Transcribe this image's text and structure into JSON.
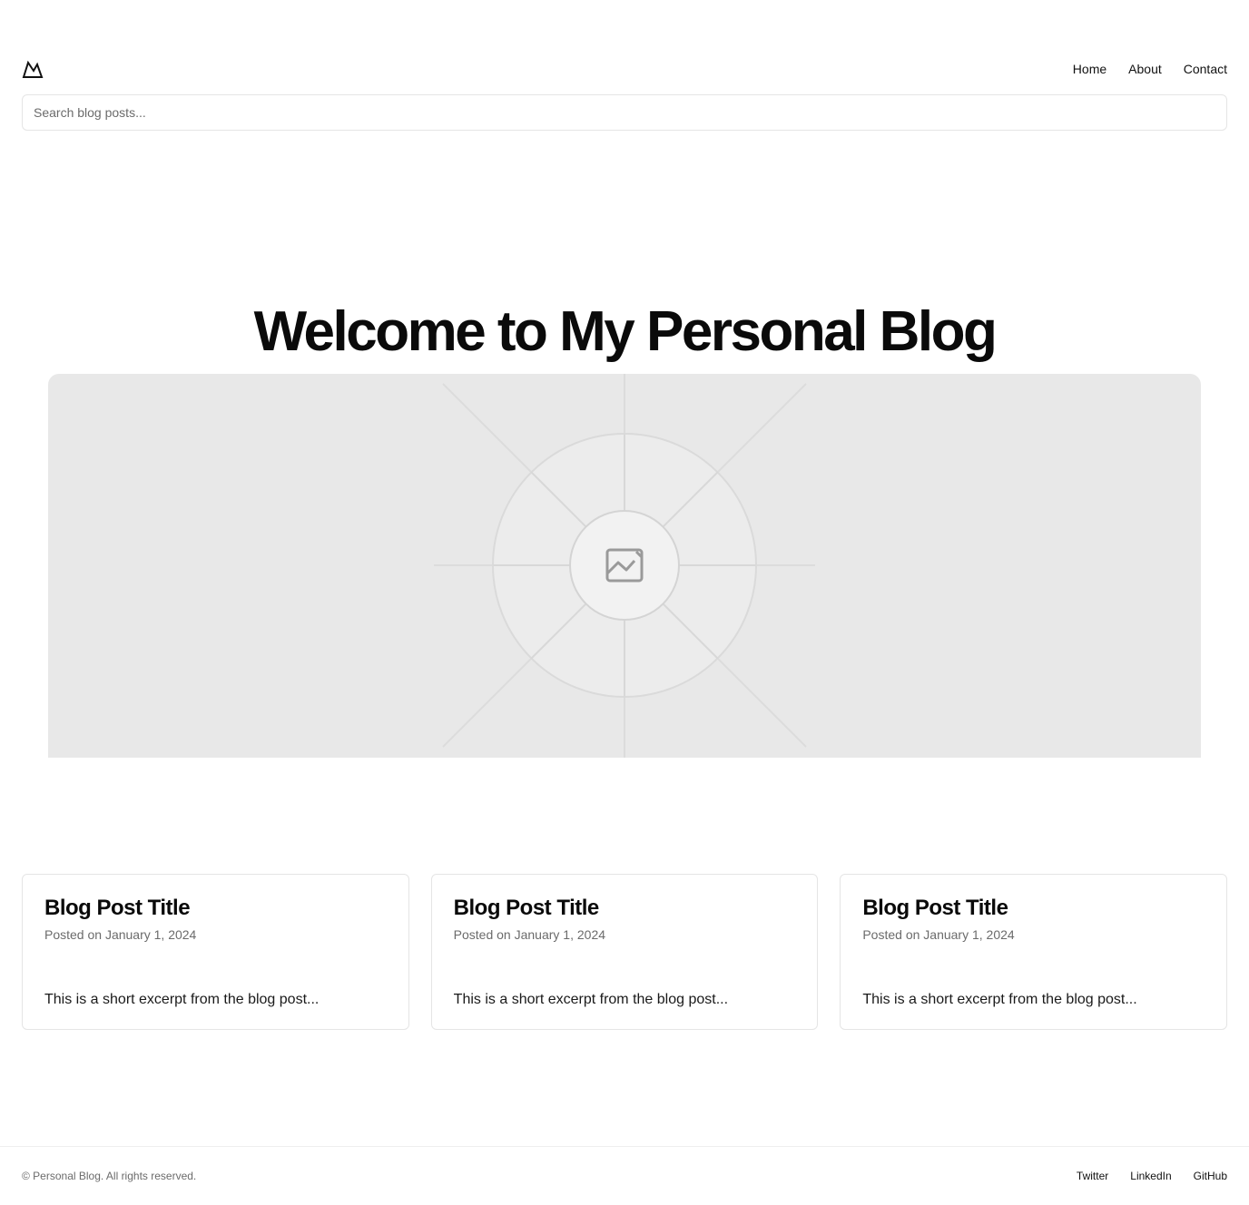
{
  "header": {
    "logo_icon": "mountain-icon",
    "nav": [
      {
        "label": "Home"
      },
      {
        "label": "About"
      },
      {
        "label": "Contact"
      }
    ]
  },
  "search": {
    "placeholder": "Search blog posts..."
  },
  "hero": {
    "title": "Welcome to My Personal Blog",
    "image_icon": "image-placeholder-icon"
  },
  "posts": [
    {
      "title": "Blog Post Title",
      "date": "Posted on January 1, 2024",
      "excerpt": "This is a short excerpt from the blog post..."
    },
    {
      "title": "Blog Post Title",
      "date": "Posted on January 1, 2024",
      "excerpt": "This is a short excerpt from the blog post..."
    },
    {
      "title": "Blog Post Title",
      "date": "Posted on January 1, 2024",
      "excerpt": "This is a short excerpt from the blog post..."
    }
  ],
  "footer": {
    "copyright": "© Personal Blog. All rights reserved.",
    "links": [
      {
        "label": "Twitter"
      },
      {
        "label": "LinkedIn"
      },
      {
        "label": "GitHub"
      }
    ]
  },
  "colors": {
    "background": "#ffffff",
    "text": "#111111",
    "muted": "#6b6b6b",
    "border": "#e5e5e5",
    "placeholder_bg": "#e8e8e8"
  }
}
